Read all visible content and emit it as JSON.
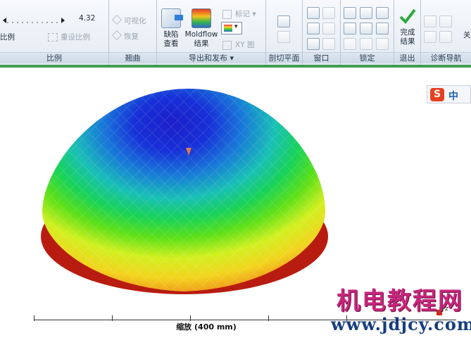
{
  "ribbon": {
    "scale": {
      "value": "4.32",
      "label_ratio": "比例",
      "reset_ratio": "重设比例",
      "group_label": "比例"
    },
    "curve": {
      "visualize": "可视化",
      "restore": "恢复",
      "group_label": "翘曲"
    },
    "export": {
      "defect_view": "缺陷\n查看",
      "defect_view_l1": "缺陷",
      "defect_view_l2": "查看",
      "moldflow_l1": "Moldflow",
      "moldflow_l2": "结果",
      "mark": "标记",
      "xy_chart": "XY 图",
      "group_label": "导出和发布"
    },
    "cut": {
      "group_label": "剖切平面"
    },
    "window": {
      "group_label": "窗口"
    },
    "lock": {
      "group_label": "锁定"
    },
    "exit": {
      "finish_l1": "完成",
      "finish_l2": "结果",
      "group_label": "退出"
    },
    "diag": {
      "group_label": "诊断导航",
      "close_label": "关"
    }
  },
  "ime": {
    "s_label": "S",
    "lang": "中"
  },
  "scale_bar": {
    "label": "缩放 (400 mm)"
  },
  "watermark": {
    "line1": "机电教程网",
    "line2": "www.jdjcy.com"
  },
  "axis_label": "z",
  "colors": {
    "green_strip": "#3f9d56",
    "accent": "#1d5fb5"
  }
}
